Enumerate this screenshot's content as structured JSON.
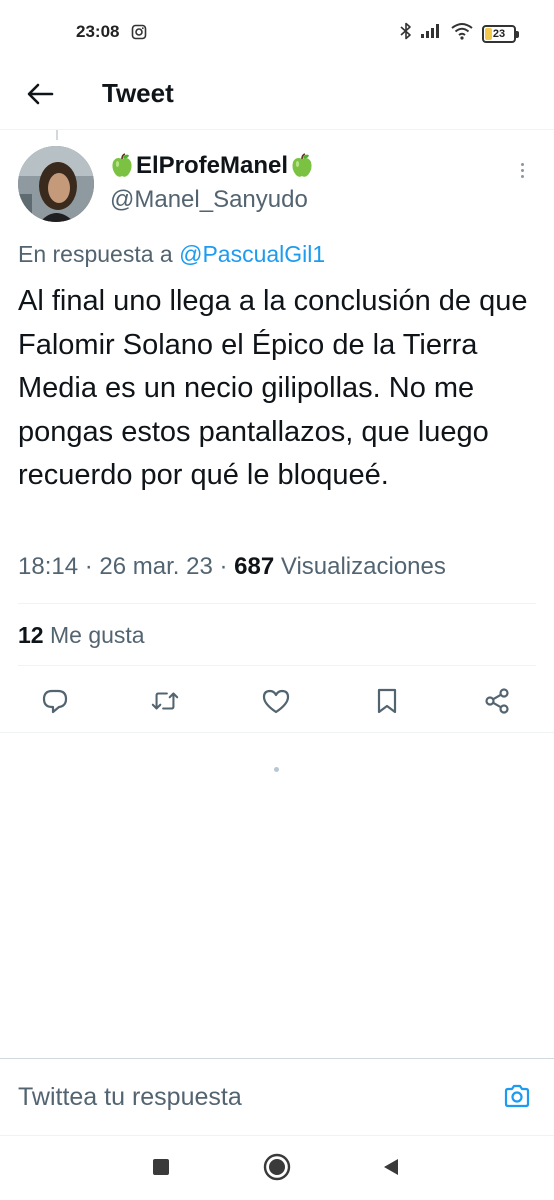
{
  "status_bar": {
    "time": "23:08",
    "battery_level": "23",
    "battery_fraction": 0.23,
    "left_icon": "camera-notification-icon",
    "right_icons": [
      "bluetooth-icon",
      "signal-icon",
      "wifi-icon",
      "battery-icon"
    ]
  },
  "header": {
    "back_icon": "back-arrow-icon",
    "title": "Tweet"
  },
  "tweet": {
    "author": {
      "display_name": "ElProfeManel",
      "name_emoji": "green-apple-icon",
      "handle": "@Manel_Sanyudo"
    },
    "reply_prefix": "En respuesta a ",
    "reply_to": "@PascualGil1",
    "text": "Al final uno llega a la conclusión de que Falomir Solano el Épico de la Tierra Media es un necio gilipollas. No me pongas estos pantallazos, que luego recuerdo por qué le bloqueé.",
    "time": "18:14",
    "date": "26 mar. 23",
    "separator": "·",
    "views_count": "687",
    "views_label": "Visualizaciones",
    "likes_count": "12",
    "likes_label": "Me gusta"
  },
  "actions": [
    "reply-icon",
    "retweet-icon",
    "like-icon",
    "bookmark-icon",
    "share-icon"
  ],
  "reply_bar": {
    "placeholder": "Twittea tu respuesta",
    "camera_icon": "camera-icon"
  },
  "nav_bar": {
    "buttons": [
      "recent-apps-icon",
      "home-icon",
      "back-triangle-icon"
    ]
  },
  "colors": {
    "accent": "#1d9bf0",
    "secondary_text": "#536471",
    "primary_text": "#0f1419",
    "divider": "#eff3f4",
    "battery": "#f2c94c"
  }
}
